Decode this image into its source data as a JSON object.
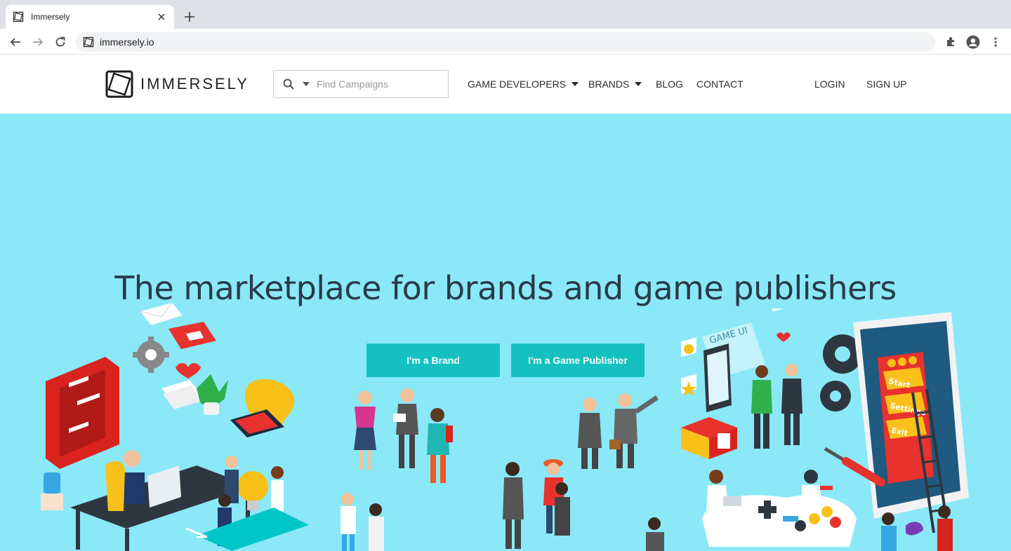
{
  "browser": {
    "tab_title": "Immersely",
    "url": "immersely.io"
  },
  "header": {
    "logo_text": "IMMERSELY",
    "search_placeholder": "Find Campaigns",
    "nav": {
      "game_developers": "GAME DEVELOPERS",
      "brands": "BRANDS",
      "blog": "BLOG",
      "contact": "CONTACT",
      "login": "LOGIN",
      "signup": "SIGN UP"
    }
  },
  "hero": {
    "title": "The marketplace for brands and game publishers",
    "cta_brand": "I'm a Brand",
    "cta_publisher": "I'm a Game Publisher",
    "illustration_text": {
      "game_ui": "GAME UI",
      "start": "Start",
      "settings": "Settings",
      "exit": "Exit"
    },
    "colors": {
      "background": "#8ae8f7",
      "button": "#14c1c0",
      "title": "#2a3a4a"
    }
  }
}
